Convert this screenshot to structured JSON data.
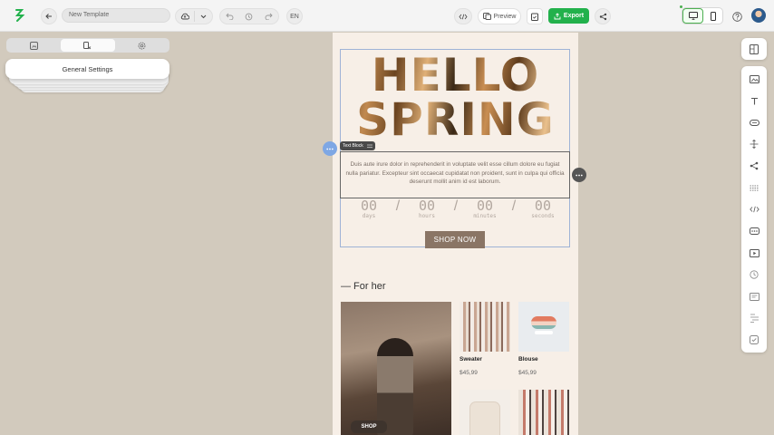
{
  "topbar": {
    "template_name": "New Template",
    "language": "EN",
    "preview_label": "Preview",
    "export_label": "Export"
  },
  "left_panel": {
    "tabs": [
      "templates-icon",
      "blocks-icon",
      "settings-icon"
    ],
    "active_tab": 1,
    "section_label": "General Settings"
  },
  "canvas": {
    "hero": {
      "line1": "HELLO",
      "line2": "SPRING"
    },
    "text_block_label": "Text Block",
    "text_block_body": "Duis aute irure dolor in reprehenderit in voluptate velit esse cillum dolore eu fugiat nulla pariatur. Excepteur sint occaecat cupidatat non proident, sunt in culpa qui officia deserunt mollit anim id est laborum.",
    "countdown": [
      {
        "value": "00",
        "label": "days"
      },
      {
        "value": "00",
        "label": "hours"
      },
      {
        "value": "00",
        "label": "minutes"
      },
      {
        "value": "00",
        "label": "seconds"
      }
    ],
    "countdown_sep": "/",
    "cta_label": "SHOP NOW",
    "section_title": "— For her",
    "feature_cta": "SHOP",
    "products": [
      {
        "name": "Sweater",
        "price": "$45,99"
      },
      {
        "name": "Blouse",
        "price": "$45,99"
      }
    ]
  },
  "right_toolbar": [
    "image-icon",
    "text-icon",
    "button-icon",
    "spacer-icon",
    "social-icon",
    "divider-icon",
    "html-icon",
    "menu-icon",
    "video-icon",
    "timer-icon",
    "banner-icon",
    "stripe-icon",
    "checklist-icon"
  ],
  "colors": {
    "accent_green": "#22b14c",
    "canvas_bg": "#f7efe7",
    "workspace_bg": "#d2cabd",
    "cta_bg": "#8a7565"
  }
}
